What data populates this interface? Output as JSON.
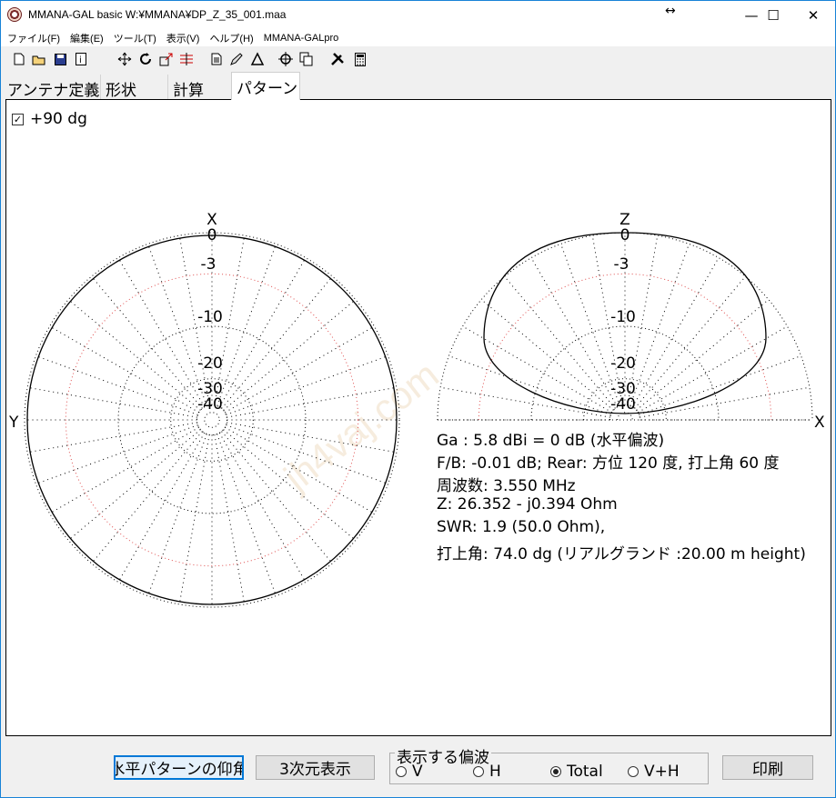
{
  "window": {
    "title": "MMANA-GAL basic  W:¥MMANA¥DP_Z_35_001.maa",
    "controls": {
      "minimize": "—",
      "maximize": "☐",
      "close": "✕"
    }
  },
  "menu": [
    "ファイル(F)",
    "編集(E)",
    "ツール(T)",
    "表示(V)",
    "ヘルプ(H)",
    "MMANA-GALpro"
  ],
  "toolbar": [
    "new-file-icon",
    "open-folder-icon",
    "save-disk-icon",
    "info-icon",
    "move-arrows-icon",
    "rotate-icon",
    "resize-icon",
    "wire-list-icon",
    "page-icon",
    "pencil-icon",
    "triangle-icon",
    "crosshair-icon",
    "copy-icon",
    "tools-icon",
    "calculator-icon"
  ],
  "tabs": [
    "アンテナ定義",
    "形状",
    "計算",
    "パターン"
  ],
  "pattern": {
    "checkbox_label": "+90 dg",
    "checkbox_checked": true,
    "left_plot": {
      "top_label": "X",
      "side_label": "Y",
      "ring_labels": [
        "0",
        "-3",
        "-10",
        "-20",
        "-30",
        "-40"
      ]
    },
    "right_plot": {
      "top_label": "Z",
      "side_label": "X",
      "ring_labels": [
        "0",
        "-3",
        "-10",
        "-20",
        "-30",
        "-40"
      ]
    },
    "watermark": "jh4vaj.com",
    "info": [
      "Ga : 5.8 dBi = 0 dB  (水平偏波)",
      "F/B: -0.01 dB; Rear: 方位 120 度,  打上角 60 度",
      "周波数: 3.550 MHz",
      "Z: 26.352 - j0.394 Ohm",
      "SWR: 1.9 (50.0 Ohm),",
      "打上角: 74.0 dg (リアルグランド  :20.00 m height)"
    ]
  },
  "bottom": {
    "elevation_button": "水平パターンの仰角",
    "view3d_button": "3次元表示",
    "polarization_label": "表示する偏波",
    "radios": [
      {
        "label": "V",
        "checked": false
      },
      {
        "label": "H",
        "checked": false
      },
      {
        "label": "Total",
        "checked": true
      },
      {
        "label": "V+H",
        "checked": false
      }
    ],
    "print_button": "印刷"
  }
}
